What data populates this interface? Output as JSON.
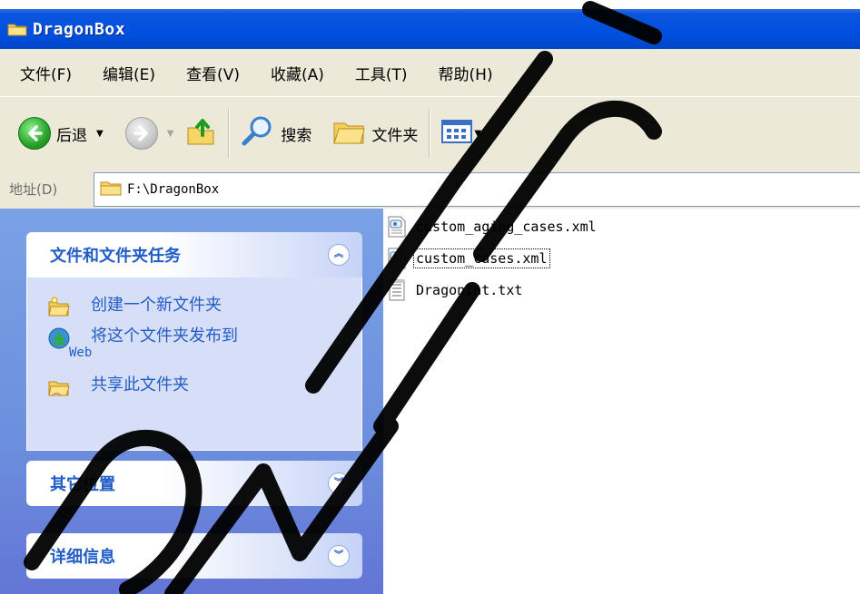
{
  "window": {
    "title": "DragonBox",
    "title_color": "#0050e0"
  },
  "menubar": {
    "items": [
      "文件(F)",
      "编辑(E)",
      "查看(V)",
      "收藏(A)",
      "工具(T)",
      "帮助(H)"
    ]
  },
  "toolbar": {
    "back_label": "后退",
    "search_label": "搜索",
    "folders_label": "文件夹",
    "icons": [
      "back-arrow-icon",
      "forward-arrow-icon",
      "up-folder-icon",
      "search-magnifier-icon",
      "folders-icon",
      "views-icon"
    ]
  },
  "address": {
    "label": "地址(D)",
    "path": "F:\\DragonBox"
  },
  "taskpane": {
    "bg_color": "#6f95df",
    "link_color": "#215dc6",
    "groups": [
      {
        "title": "文件和文件夹任务",
        "expanded": true,
        "tasks": [
          {
            "label": "创建一个新文件夹",
            "icon": "new-folder-icon"
          },
          {
            "label": "将这个文件夹发布到",
            "sub": "Web",
            "icon": "publish-web-icon"
          },
          {
            "label": "共享此文件夹",
            "icon": "share-folder-icon"
          }
        ]
      },
      {
        "title": "其它位置",
        "expanded": false
      },
      {
        "title": "详细信息",
        "expanded": false
      }
    ]
  },
  "files": [
    {
      "name": "custom_aging_cases.xml",
      "type": "xml",
      "focused": false
    },
    {
      "name": "custom_cases.xml",
      "type": "xml",
      "focused": true
    },
    {
      "name": "DragonInt.txt",
      "type": "txt",
      "focused": false
    }
  ]
}
